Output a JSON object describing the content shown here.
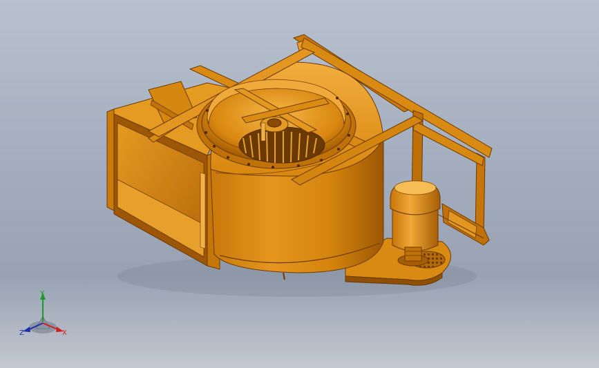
{
  "viewport": {
    "background_top": "#b9c1cf",
    "background_bottom": "#98a2b3"
  },
  "model": {
    "subject": "centrifugal-fan-assembly",
    "color_main": "#d8860a",
    "color_light": "#f0a93a",
    "color_dark": "#8a4c03",
    "color_shadow": "#5e3402"
  },
  "triad": {
    "x_label": "X",
    "y_label": "Y",
    "z_label": "Z",
    "x_color": "#d22020",
    "y_color": "#1b9a2a",
    "z_color": "#1f2fb0"
  }
}
